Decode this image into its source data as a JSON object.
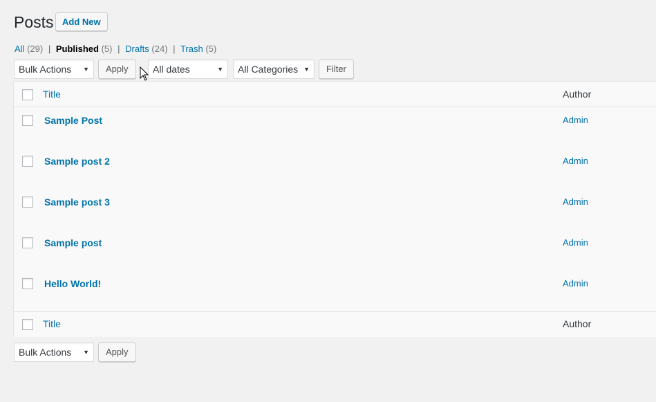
{
  "header": {
    "title": "Posts",
    "add_new": "Add New"
  },
  "filters": {
    "all_label": "All",
    "all_count": "(29)",
    "published_label": "Published",
    "published_count": "(5)",
    "drafts_label": "Drafts",
    "drafts_count": "(24)",
    "trash_label": "Trash",
    "trash_count": "(5)",
    "separator": "|"
  },
  "toolbar_top": {
    "bulk_actions": "Bulk Actions",
    "apply": "Apply",
    "dates": "All dates",
    "categories": "All Categories",
    "filter": "Filter"
  },
  "table": {
    "columns": {
      "title": "Title",
      "author": "Author"
    },
    "rows": [
      {
        "title": "Sample Post",
        "author": "Admin"
      },
      {
        "title": "Sample post 2",
        "author": "Admin"
      },
      {
        "title": "Sample post 3",
        "author": "Admin"
      },
      {
        "title": "Sample post",
        "author": "Admin"
      },
      {
        "title": "Hello World!",
        "author": "Admin"
      }
    ]
  },
  "toolbar_bottom": {
    "bulk_actions": "Bulk Actions",
    "apply": "Apply"
  },
  "icons": {
    "dropdown": "triangle-down-icon",
    "cursor": "mouse-pointer-icon"
  },
  "colors": {
    "link": "#0073aa",
    "background": "#f1f1f1"
  }
}
